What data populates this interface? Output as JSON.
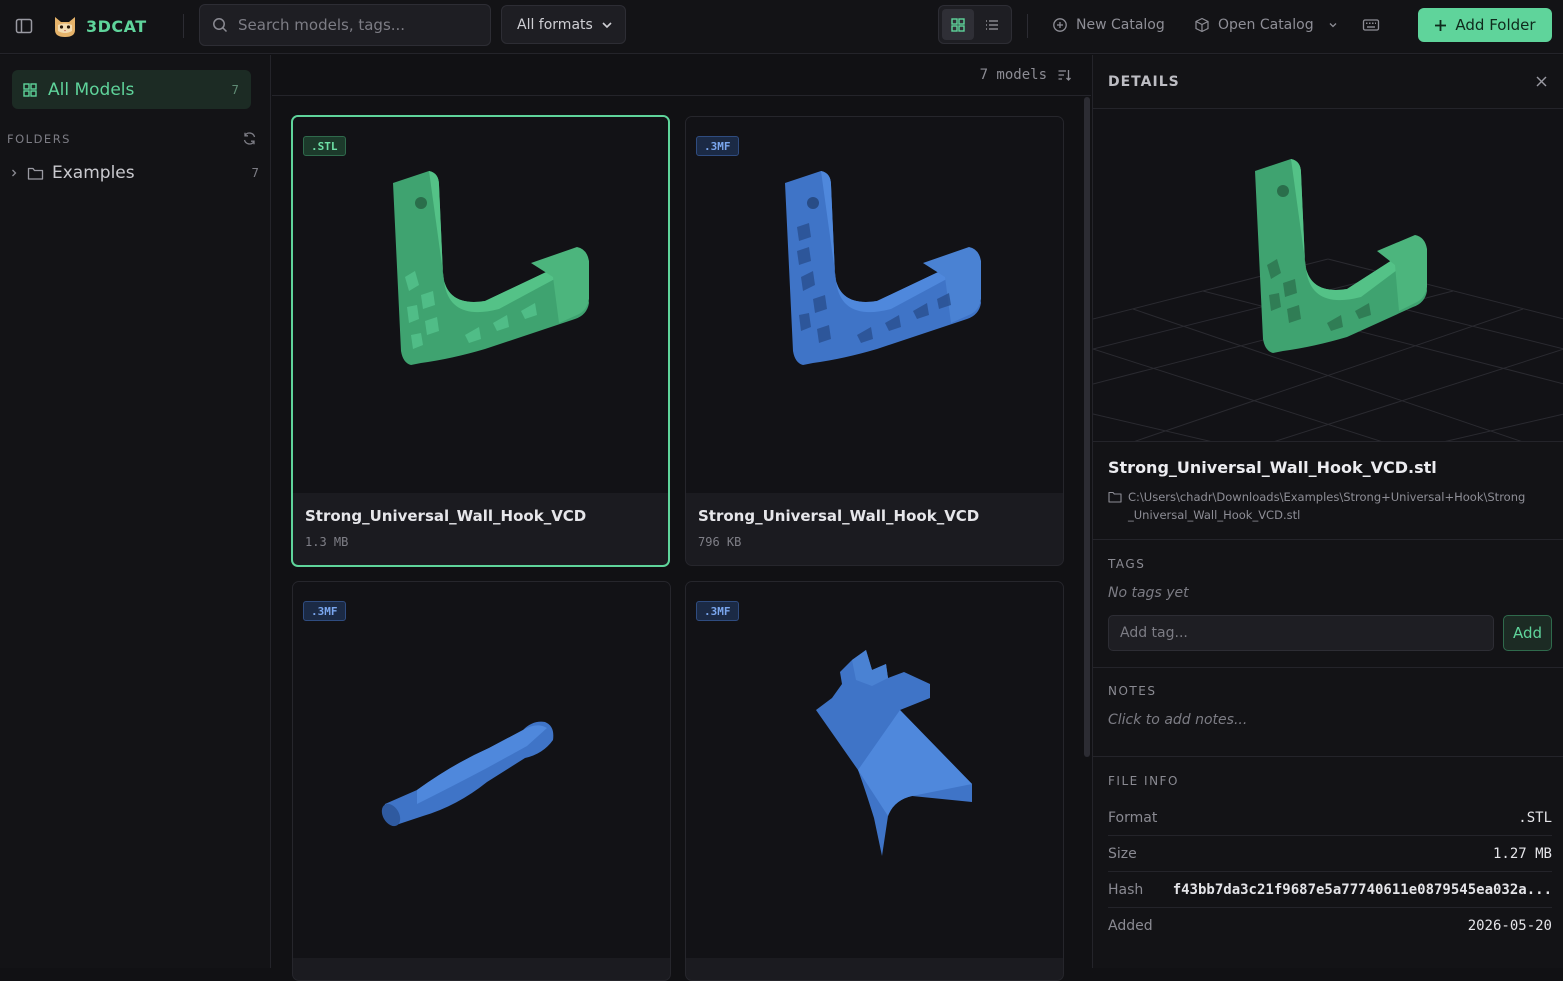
{
  "app": {
    "name": "3DCAT"
  },
  "search": {
    "placeholder": "Search models, tags..."
  },
  "format_filter": {
    "selected": "All formats"
  },
  "toolbar": {
    "new_catalog": "New Catalog",
    "open_catalog": "Open Catalog",
    "add_folder": "Add Folder"
  },
  "sidebar": {
    "all_models": {
      "label": "All Models",
      "count": "7"
    },
    "folders_title": "FOLDERS",
    "folders": [
      {
        "label": "Examples",
        "count": "7"
      }
    ]
  },
  "main": {
    "model_count": "7 models",
    "cards": [
      {
        "format": ".STL",
        "name": "Strong_Universal_Wall_Hook_VCD",
        "size": "1.3 MB"
      },
      {
        "format": ".3MF",
        "name": "Strong_Universal_Wall_Hook_VCD",
        "size": "796 KB"
      },
      {
        "format": ".3MF",
        "name": "",
        "size": ""
      },
      {
        "format": ".3MF",
        "name": "",
        "size": ""
      }
    ]
  },
  "details": {
    "title": "DETAILS",
    "file_name": "Strong_Universal_Wall_Hook_VCD.stl",
    "path": "C:\\Users\\chadr\\Downloads\\Examples\\Strong+Universal+Hook\\Strong_Universal_Wall_Hook_VCD.stl",
    "tags_title": "TAGS",
    "no_tags": "No tags yet",
    "tag_placeholder": "Add tag...",
    "tag_add": "Add",
    "notes_title": "NOTES",
    "notes_placeholder": "Click to add notes...",
    "file_info_title": "FILE INFO",
    "info": [
      {
        "key": "Format",
        "value": ".STL"
      },
      {
        "key": "Size",
        "value": "1.27 MB"
      },
      {
        "key": "Hash",
        "value": "f43bb7da3c21f9687e5a77740611e0879545ea032a..."
      },
      {
        "key": "Added",
        "value": "2026-05-20"
      }
    ]
  },
  "colors": {
    "accent": "#5fd49b",
    "model_green": "#3fa370",
    "model_blue": "#3f74c7"
  },
  "icons": [
    "sidebar-toggle-icon",
    "cat-logo-icon",
    "search-icon",
    "chevron-down-icon",
    "grid-icon",
    "list-icon",
    "plus-circle-icon",
    "cube-icon",
    "keyboard-icon",
    "plus-icon",
    "grid-icon",
    "refresh-icon",
    "chevron-right-icon",
    "folder-icon",
    "sort-icon",
    "close-icon",
    "folder-icon"
  ]
}
